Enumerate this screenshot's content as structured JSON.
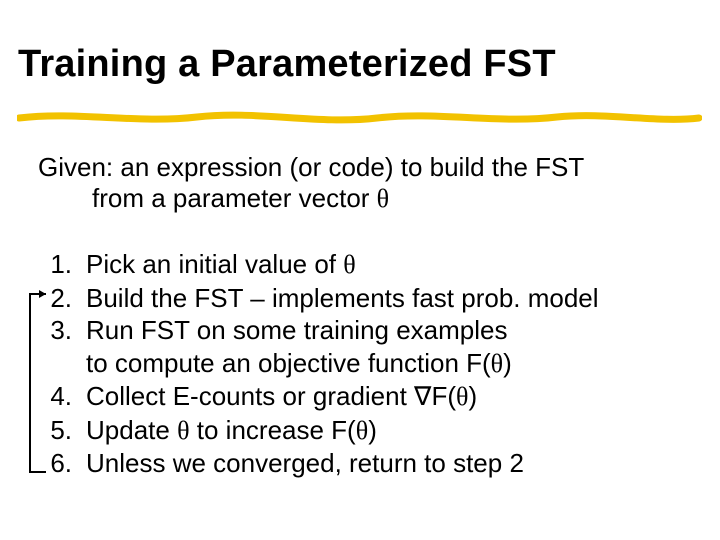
{
  "title": "Training a Parameterized FST",
  "intro": {
    "line1": "Given: an expression (or code) to build the FST",
    "line2_prefix": "from a parameter vector ",
    "theta": "θ"
  },
  "items": [
    {
      "n": "1.",
      "text_pre": "Pick an initial value of ",
      "theta": "θ",
      "text_post": ""
    },
    {
      "n": "2.",
      "text_pre": "Build the FST – implements fast prob. model",
      "theta": "",
      "text_post": ""
    },
    {
      "n": "3.",
      "text_pre": "Run FST on some training examples",
      "theta": "",
      "text_post": "",
      "sub_pre": "to compute an objective function F(",
      "sub_theta": "θ",
      "sub_post": ")"
    },
    {
      "n": "4.",
      "text_pre": "Collect E-counts or gradient ∇F(",
      "theta": "θ",
      "text_post": ")"
    },
    {
      "n": "5.",
      "text_pre": "Update ",
      "theta": "θ",
      "text_post": " to increase F(",
      "theta2": "θ",
      "text_post2": ")"
    },
    {
      "n": "6.",
      "text_pre": "Unless we converged, return to step 2",
      "theta": "",
      "text_post": ""
    }
  ]
}
